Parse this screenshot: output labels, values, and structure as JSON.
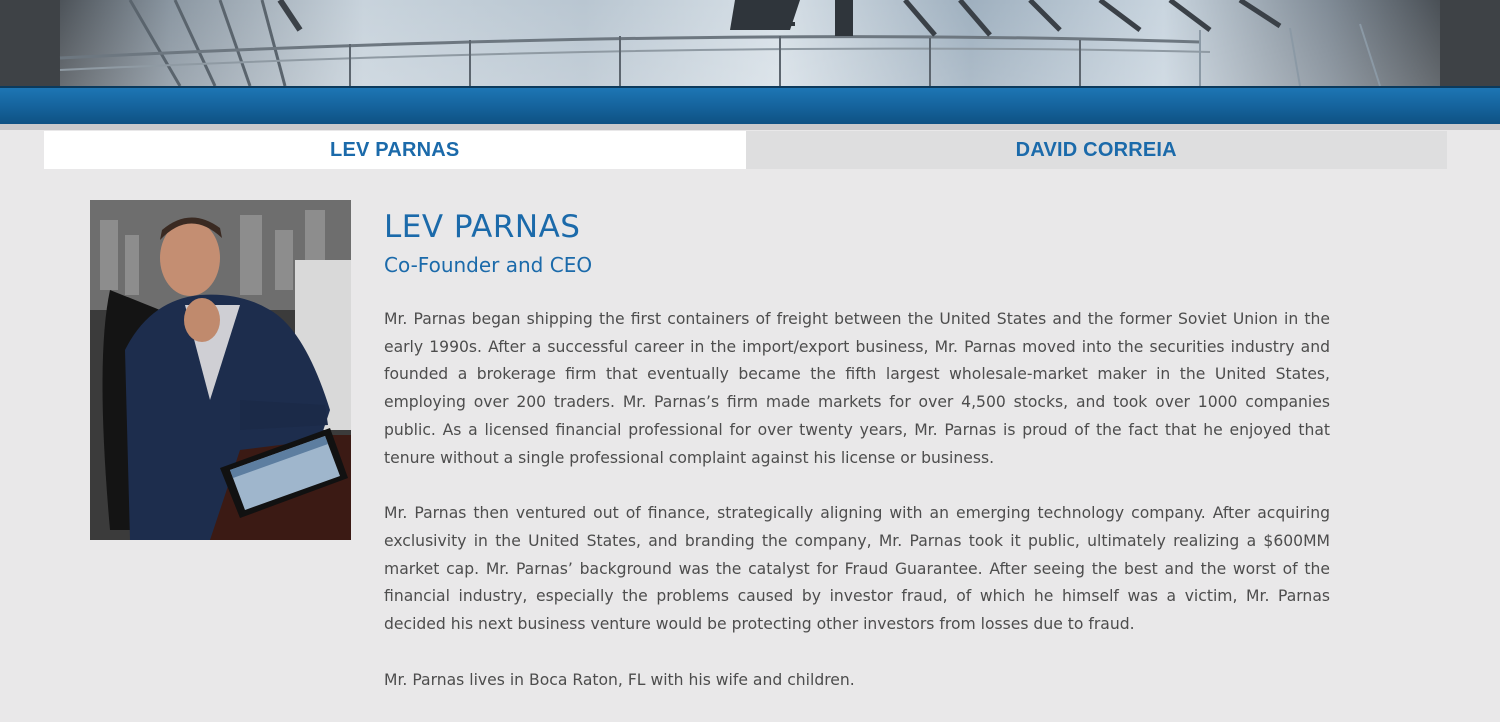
{
  "tabs": [
    {
      "label": "LEV PARNAS",
      "active": true
    },
    {
      "label": "DAVID CORREIA",
      "active": false
    }
  ],
  "profile": {
    "name": "LEV PARNAS",
    "role": "Co-Founder and CEO",
    "paragraphs": [
      "Mr. Parnas began shipping the first containers of freight between the United States and the former Soviet Union in the early 1990s. After a successful career in the import/export business, Mr. Parnas moved into the securities industry and founded a brokerage firm that eventually became the fifth largest wholesale-market maker in the United States, employing over 200 traders. Mr. Parnas’s firm made markets for over 4,500 stocks, and took over 1000 companies public. As a licensed financial professional for over twenty years, Mr. Parnas is proud of the fact that he enjoyed that tenure without a single professional complaint against his license or business.",
      "Mr. Parnas then ventured out of finance, strategically aligning with an emerging technology company. After acquiring exclusivity in the United States, and branding the company, Mr. Parnas took it public, ultimately realizing a $600MM market cap. Mr. Parnas’ background was the catalyst for Fraud Guarantee. After seeing the best and the worst of the financial industry, especially the problems caused by investor fraud, of which he himself was a victim, Mr. Parnas decided his next business venture would be protecting other investors from losses due to fraud.",
      "Mr. Parnas lives in Boca Raton, FL with his wife and children."
    ]
  },
  "colors": {
    "accent": "#1b6aaa",
    "band": "#15639c",
    "page_bg": "#e9e8e9",
    "text": "#4d4d4d"
  }
}
